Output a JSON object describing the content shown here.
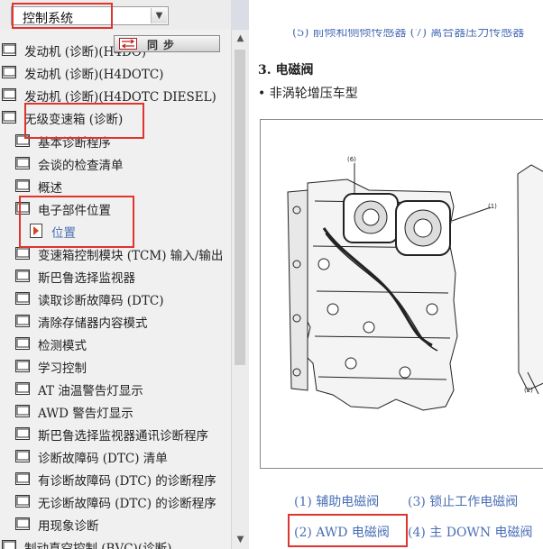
{
  "nav": {
    "selector": {
      "value": "控制系统"
    },
    "sync_button": {
      "label": "同步"
    },
    "tree": [
      {
        "label": "发动机 (诊断)(H4DO)"
      },
      {
        "label": "发动机 (诊断)(H4DOTC)"
      },
      {
        "label": "发动机 (诊断)(H4DOTC DIESEL)"
      },
      {
        "label": "无级变速箱 (诊断)"
      },
      {
        "label": "基本诊断程序"
      },
      {
        "label": "会谈的检查清单"
      },
      {
        "label": "概述"
      },
      {
        "label": "电子部件位置"
      },
      {
        "label": "位置"
      },
      {
        "label": "变速箱控制模块 (TCM) 输入/输出"
      },
      {
        "label": "斯巴鲁选择监视器"
      },
      {
        "label": "读取诊断故障码 (DTC)"
      },
      {
        "label": "清除存储器内容模式"
      },
      {
        "label": "检测模式"
      },
      {
        "label": "学习控制"
      },
      {
        "label": "AT 油温警告灯显示"
      },
      {
        "label": "AWD 警告灯显示"
      },
      {
        "label": "斯巴鲁选择监视器通讯诊断程序"
      },
      {
        "label": "诊断故障码 (DTC) 清单"
      },
      {
        "label": "有诊断故障码 (DTC) 的诊断程序"
      },
      {
        "label": "无诊断故障码 (DTC) 的诊断程序"
      },
      {
        "label": "用现象诊断"
      },
      {
        "label": "制动真空控制 (BVC)(诊断)"
      }
    ]
  },
  "content": {
    "prev_links": "(5) 前倾和侧倾传感器  (7) 离合器压力传感器",
    "heading": "3. 电磁阀",
    "subheading": "• 非涡轮增压车型",
    "figure": {
      "callouts": [
        "(6)",
        "(1)",
        "(2)"
      ]
    },
    "links": [
      "(1) 辅助电磁阀",
      "(3) 锁止工作电磁阀",
      "(2) AWD 电磁阀",
      "(4) 主 DOWN 电磁阀"
    ]
  }
}
